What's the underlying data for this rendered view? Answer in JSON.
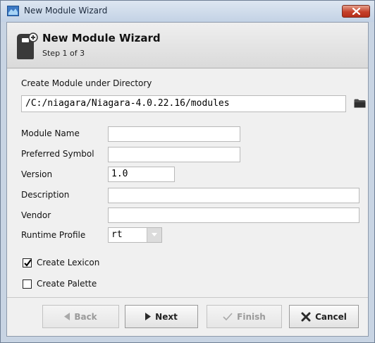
{
  "window": {
    "title": "New Module Wizard",
    "icons": {
      "app": "module-app-icon",
      "close": "close-icon"
    }
  },
  "header": {
    "title": "New Module Wizard",
    "step": "Step 1 of 3",
    "icon": "new-module-icon"
  },
  "directory": {
    "label": "Create Module under Directory",
    "value": "/C:/niagara/Niagara-4.0.22.16/modules",
    "browse_icon": "folder-icon"
  },
  "form": {
    "module_name": {
      "label": "Module Name",
      "value": ""
    },
    "preferred_symbol": {
      "label": "Preferred Symbol",
      "value": ""
    },
    "version": {
      "label": "Version",
      "value": "1.0"
    },
    "description": {
      "label": "Description",
      "value": ""
    },
    "vendor": {
      "label": "Vendor",
      "value": ""
    },
    "runtime_profile": {
      "label": "Runtime Profile",
      "value": "rt"
    }
  },
  "options": {
    "create_lexicon": {
      "label": "Create Lexicon",
      "checked": true
    },
    "create_palette": {
      "label": "Create Palette",
      "checked": false
    }
  },
  "buttons": {
    "back": {
      "label": "Back",
      "enabled": false,
      "icon": "arrow-left-icon"
    },
    "next": {
      "label": "Next",
      "enabled": true,
      "icon": "arrow-right-icon"
    },
    "finish": {
      "label": "Finish",
      "enabled": false,
      "icon": "checkmark-icon"
    },
    "cancel": {
      "label": "Cancel",
      "enabled": true,
      "icon": "x-icon"
    }
  }
}
